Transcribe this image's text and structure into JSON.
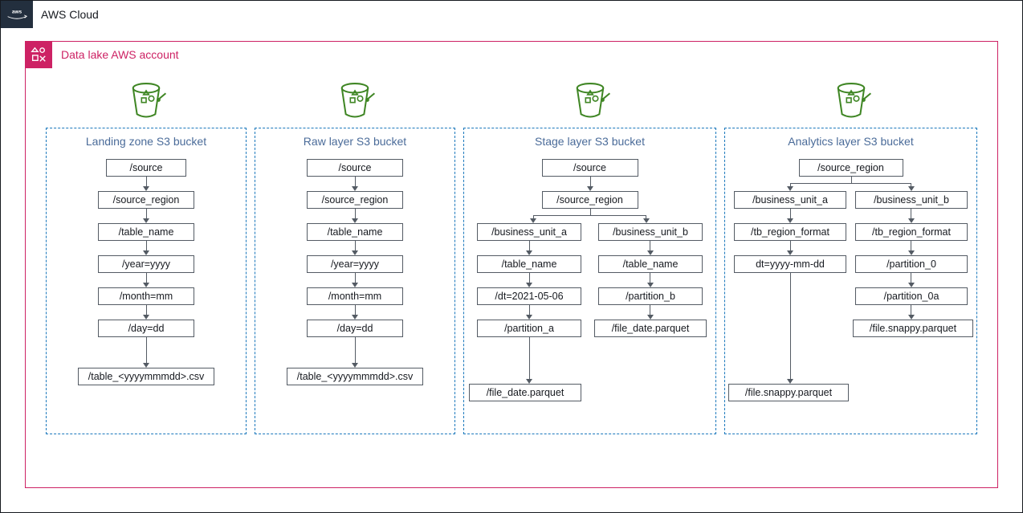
{
  "cloud": {
    "title": "AWS Cloud"
  },
  "account": {
    "title": "Data lake AWS account"
  },
  "buckets": {
    "landing": {
      "title": "Landing zone S3 bucket",
      "n0": "/source",
      "n1": "/source_region",
      "n2": "/table_name",
      "n3": "/year=yyyy",
      "n4": "/month=mm",
      "n5": "/day=dd",
      "n6": "/table_<yyyymmmdd>.csv"
    },
    "raw": {
      "title": "Raw layer S3 bucket",
      "n0": "/source",
      "n1": "/source_region",
      "n2": "/table_name",
      "n3": "/year=yyyy",
      "n4": "/month=mm",
      "n5": "/day=dd",
      "n6": "/table_<yyyymmmdd>.csv"
    },
    "stage": {
      "title": "Stage layer S3 bucket",
      "n0": "/source",
      "n1": "/source_region",
      "la0": "/business_unit_a",
      "la1": "/table_name",
      "la2": "/dt=2021-05-06",
      "la3": "/partition_a",
      "la4": "/file_date.parquet",
      "lb0": "/business_unit_b",
      "lb1": "/table_name",
      "lb2": "/partition_b",
      "lb3": "/file_date.parquet"
    },
    "analytics": {
      "title": "Analytics layer S3 bucket",
      "n0": "/source_region",
      "la0": "/business_unit_a",
      "la1": "/tb_region_format",
      "la2": "dt=yyyy-mm-dd",
      "la3": "/file.snappy.parquet",
      "lb0": "/business_unit_b",
      "lb1": "/tb_region_format",
      "lb2": "/partition_0",
      "lb3": "/partition_0a",
      "lb4": "/file.snappy.parquet"
    }
  }
}
